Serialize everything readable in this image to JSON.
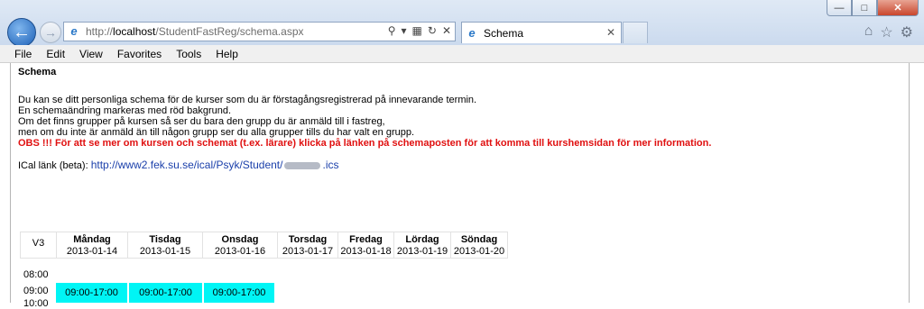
{
  "window": {
    "controls": {
      "minimize": "—",
      "maximize": "□",
      "close": "✕"
    }
  },
  "nav": {
    "back_icon": "arrow-left-icon",
    "forward_icon": "arrow-right-icon"
  },
  "address": {
    "scheme": "http://",
    "host": "localhost",
    "path": "/StudentFastReg/schema.aspx"
  },
  "tab": {
    "title": "Schema"
  },
  "menu": [
    "File",
    "Edit",
    "View",
    "Favorites",
    "Tools",
    "Help"
  ],
  "page": {
    "title": "Schema",
    "intro_lines": [
      "Du kan se ditt personliga schema för de kurser som du är förstagångsregistrerad på innevarande termin.",
      "En schemaändring markeras med röd bakgrund.",
      "Om det finns grupper på kursen så ser du bara den grupp du är anmäld till i fastreg,",
      "men om du inte är anmäld än till någon grupp ser du alla grupper tills du har valt en grupp."
    ],
    "obs": "OBS !!! För att se mer om kursen och schemat (t.ex. lärare) klicka på länken på schemaposten för att komma till kurshemsidan för mer information.",
    "ical_label": "ICal länk (beta):",
    "ical_link_start": "http://www2.fek.su.se/ical/Psyk/Student/",
    "ical_link_end": ".ics"
  },
  "schedule": {
    "week": "V3",
    "days": [
      {
        "name": "Måndag",
        "date": "2013-01-14"
      },
      {
        "name": "Tisdag",
        "date": "2013-01-15"
      },
      {
        "name": "Onsdag",
        "date": "2013-01-16"
      },
      {
        "name": "Torsdag",
        "date": "2013-01-17"
      },
      {
        "name": "Fredag",
        "date": "2013-01-18"
      },
      {
        "name": "Lördag",
        "date": "2013-01-19"
      },
      {
        "name": "Söndag",
        "date": "2013-01-20"
      }
    ],
    "times": [
      "08:00",
      "09:00",
      "10:00"
    ],
    "slots": [
      {
        "day": "Måndag",
        "label": "09:00-17:00"
      },
      {
        "day": "Tisdag",
        "label": "09:00-17:00"
      },
      {
        "day": "Onsdag",
        "label": "09:00-17:00"
      }
    ]
  },
  "colors": {
    "obs": "#e01010",
    "slot": "#00f5f5",
    "link": "#1a3faa"
  }
}
